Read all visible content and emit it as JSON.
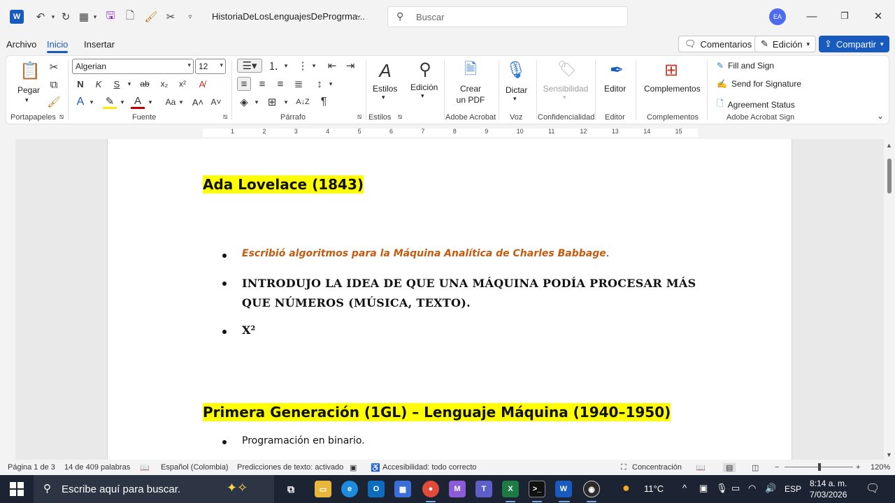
{
  "titlebar": {
    "doc_title": "HistoriaDeLosLenguajesDeProgrma...",
    "search_placeholder": "Buscar",
    "avatar_initials": "EA"
  },
  "menu": {
    "tabs": [
      "Archivo",
      "Inicio",
      "Insertar"
    ],
    "comments_label": "Comentarios",
    "editing_label": "Edición",
    "share_label": "Compartir"
  },
  "ribbon": {
    "paste_label": "Pegar",
    "font_name": "Algerian",
    "font_size": "12",
    "bold": "N",
    "italic": "K",
    "underline": "S",
    "strike": "ab",
    "change_case": "Aa",
    "styles_label": "Estilos",
    "editing_btn": "Edición",
    "create_pdf_1": "Crear",
    "create_pdf_2": "un PDF",
    "dictate_label": "Dictar",
    "sensitivity_label": "Sensibilidad",
    "editor_label": "Editor",
    "addins_label": "Complementos",
    "fill_sign": "Fill and Sign",
    "send_signature": "Send for Signature",
    "agreement_status": "Agreement Status",
    "groups": {
      "clipboard": "Portapapeles",
      "font": "Fuente",
      "paragraph": "Párrafo",
      "styles": "Estilos",
      "acrobat": "Adobe Acrobat",
      "voice": "Voz",
      "sensitivity": "Confidencialidad",
      "editor": "Editor",
      "addins": "Complementos",
      "acrobat_sign": "Adobe Acrobat Sign"
    }
  },
  "ruler": {
    "numbers": [
      "1",
      "2",
      "3",
      "4",
      "5",
      "6",
      "7",
      "8",
      "9",
      "10",
      "11",
      "12",
      "13",
      "14",
      "15"
    ]
  },
  "document": {
    "heading1": "Ada Lovelace (1843)",
    "bullet1": "Escribió algoritmos para la Máquina Analítica de Charles Babbage",
    "bullet1_suffix": ".",
    "bullet2": "Introdujo la idea de que una máquina podía procesar más que números (música, texto).",
    "bullet3": "X²",
    "heading2": "Primera Generación (1GL) – Lenguaje Máquina (1940–1950)",
    "bullet4": "Programación en binario."
  },
  "statusbar": {
    "page": "Página 1 de 3",
    "words": "14 de 409 palabras",
    "language": "Español (Colombia)",
    "predictions": "Predicciones de texto: activado",
    "accessibility": "Accesibilidad: todo correcto",
    "focus": "Concentración",
    "zoom": "120%"
  },
  "taskbar": {
    "search_text": "Escribe aquí para buscar.",
    "weather": "11°C",
    "lang": "ESP",
    "time": "8:14 a. m.",
    "date": "7/03/2026"
  },
  "colors": {
    "accent": "#185abd",
    "highlight": "#ffff00",
    "orange_text": "#c55a11",
    "taskbar": "#1c2434"
  }
}
